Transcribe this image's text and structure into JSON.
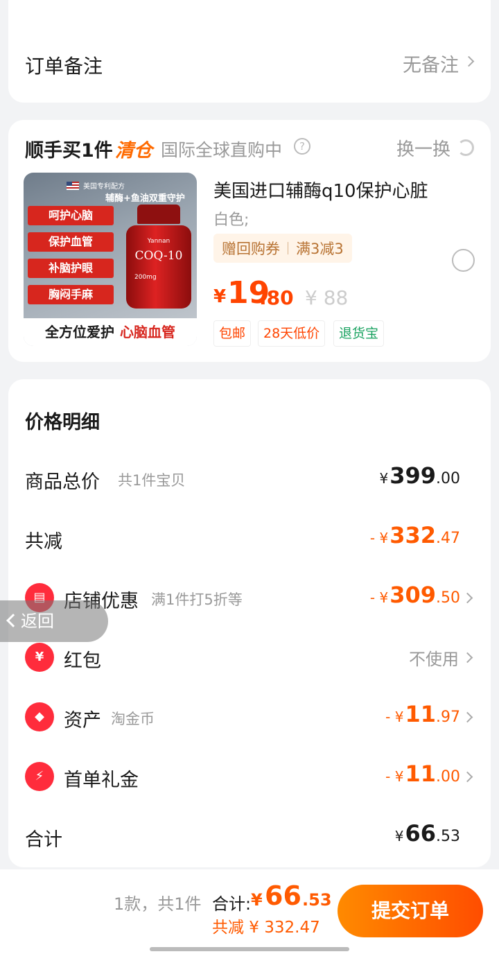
{
  "remark": {
    "label": "订单备注",
    "value": "无备注"
  },
  "promo": {
    "title": "顺手买1件",
    "tag": "清仓",
    "subtitle": "国际全球直购中",
    "swap_label": "换一换"
  },
  "product": {
    "image": {
      "top_text": "美国专利配方",
      "headline": "辅酶+鱼油双重守护",
      "pills": [
        "呵护心脑",
        "保护血管",
        "补脑护眼",
        "胸闷手麻"
      ],
      "brand": "Yannan",
      "label": "COQ-10",
      "dose": "200mg",
      "bottom_a": "全方位爱护",
      "bottom_b": "心脑血管"
    },
    "name": "美国进口辅酶q10保护心脏",
    "spec": "白色;",
    "coupon_a": "赠回购券",
    "coupon_b": "满3减3",
    "price_currency": "¥",
    "price_int": "19",
    "price_dec": ".80",
    "original_price": "¥ 88",
    "tags": [
      "包邮",
      "28天低价",
      "退货宝"
    ]
  },
  "detail": {
    "title": "价格明细",
    "rows": {
      "total": {
        "label": "商品总价",
        "sub": "共1件宝贝",
        "sign": "¥",
        "int": "399",
        "dec": ".00"
      },
      "discount": {
        "label": "共减",
        "sign": "- ¥",
        "int": "332",
        "dec": ".47"
      },
      "store": {
        "label": "店铺优惠",
        "sub": "满1件打5折等",
        "sign": "- ¥",
        "int": "309",
        "dec": ".50"
      },
      "redpacket": {
        "label": "红包",
        "value": "不使用"
      },
      "assets": {
        "label": "资产",
        "sub": "淘金币",
        "sign": "- ¥",
        "int": "11",
        "dec": ".97"
      },
      "first": {
        "label": "首单礼金",
        "sign": "- ¥",
        "int": "11",
        "dec": ".00"
      },
      "sum": {
        "label": "合计",
        "sign": "¥",
        "int": "66",
        "dec": ".53"
      }
    }
  },
  "back": {
    "label": "返回"
  },
  "footer": {
    "count": "1款，共1件",
    "total_label": "合计:",
    "total_currency": "¥",
    "total_int": "66",
    "total_dec": ".53",
    "saved": "共减 ¥ 332.47",
    "submit": "提交订单"
  }
}
